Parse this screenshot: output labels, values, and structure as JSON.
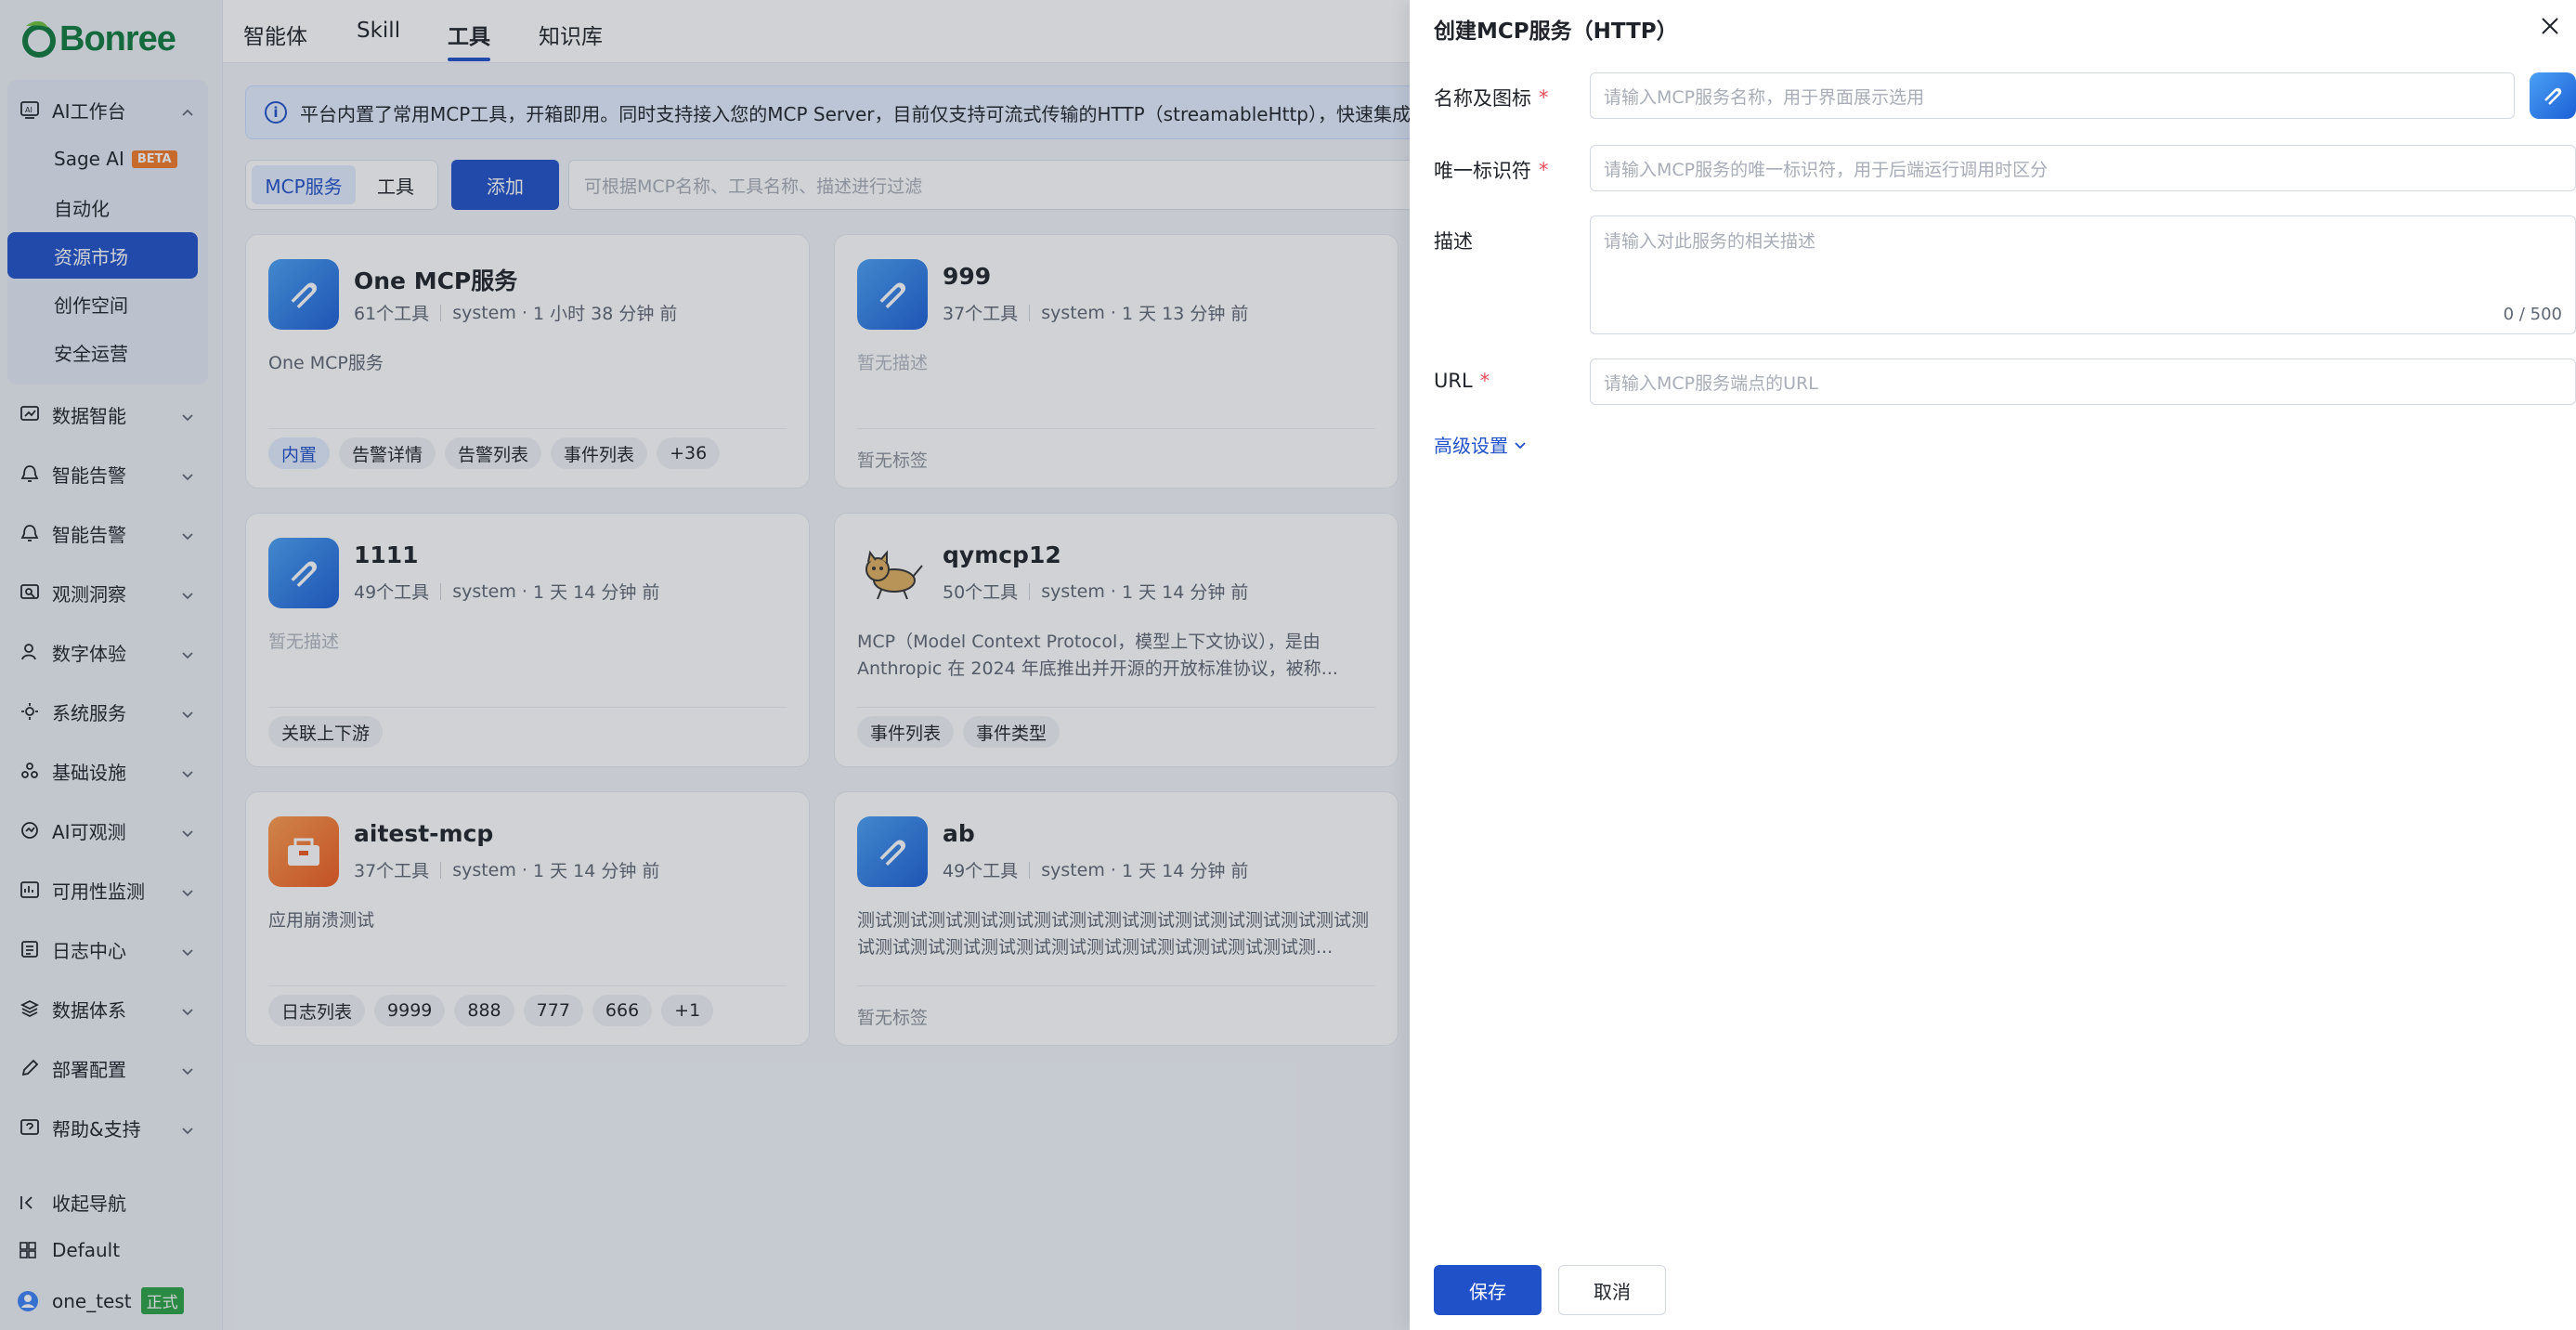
{
  "brand": {
    "name": "Bonree",
    "color": "#0f7a3c"
  },
  "colors": {
    "accent": "#2151c8",
    "beta": "#f47a2a",
    "prod": "#2ba245",
    "required": "#e34d59"
  },
  "sidebar": {
    "group_open": {
      "label": "AI工作台",
      "icon": "ai-workbench-icon",
      "children": [
        {
          "label": "Sage AI",
          "badge": "BETA"
        },
        {
          "label": "自动化"
        },
        {
          "label": "资源市场",
          "active": true
        },
        {
          "label": "创作空间"
        },
        {
          "label": "安全运营"
        }
      ]
    },
    "groups": [
      {
        "label": "数据智能",
        "icon": "data-intelligence-icon"
      },
      {
        "label": "智能告警",
        "icon": "alert-icon"
      },
      {
        "label": "智能告警",
        "icon": "alert-icon"
      },
      {
        "label": "观测洞察",
        "icon": "observe-icon"
      },
      {
        "label": "数字体验",
        "icon": "user-experience-icon"
      },
      {
        "label": "系统服务",
        "icon": "system-service-icon"
      },
      {
        "label": "基础设施",
        "icon": "infrastructure-icon"
      },
      {
        "label": "AI可观测",
        "icon": "ai-observe-icon"
      },
      {
        "label": "可用性监测",
        "icon": "availability-icon"
      },
      {
        "label": "日志中心",
        "icon": "log-icon"
      },
      {
        "label": "数据体系",
        "icon": "data-system-icon"
      },
      {
        "label": "部署配置",
        "icon": "deploy-icon"
      },
      {
        "label": "帮助&支持",
        "icon": "help-icon"
      }
    ],
    "collapse": "收起导航",
    "workspace": "Default",
    "user": {
      "name": "one_test",
      "env": "正式"
    }
  },
  "top_tabs": [
    "智能体",
    "Skill",
    "工具",
    "知识库"
  ],
  "active_tab": "工具",
  "notice": "平台内置了常用MCP工具，开箱即用。同时支持接入您的MCP Server，目前仅支持可流式传输的HTTP（streamableHttp），快速集成",
  "segment": {
    "mcp": "MCP服务",
    "tools": "工具"
  },
  "add_button": "添加",
  "filter_placeholder": "可根据MCP名称、工具名称、描述进行过滤",
  "cards": [
    {
      "title": "One MCP服务",
      "tools": "61个工具",
      "owner": "system",
      "time": "1 小时 38 分钟 前",
      "desc": "One MCP服务",
      "desc_muted": false,
      "tags": [
        "内置",
        "告警详情",
        "告警列表",
        "事件列表",
        "+36"
      ],
      "no_tags": ""
    },
    {
      "title": "999",
      "tools": "37个工具",
      "owner": "system",
      "time": "1 天 13 分钟 前",
      "desc": "暂无描述",
      "desc_muted": true,
      "tags": [],
      "no_tags": "暂无标签"
    },
    {
      "title": "1111",
      "tools": "49个工具",
      "owner": "system",
      "time": "1 天 14 分钟 前",
      "desc": "暂无描述",
      "desc_muted": true,
      "tags": [
        "关联上下游"
      ],
      "no_tags": ""
    },
    {
      "title": "qymcp12",
      "tools": "50个工具",
      "owner": "system",
      "time": "1 天 14 分钟 前",
      "desc": "MCP（Model Context Protocol，模型上下文协议），是由Anthropic 在 2024 年底推出并开源的开放标准协议，被称...",
      "desc_muted": false,
      "tags": [
        "事件列表",
        "事件类型"
      ],
      "no_tags": ""
    },
    {
      "title": "aitest-mcp",
      "tools": "37个工具",
      "owner": "system",
      "time": "1 天 14 分钟 前",
      "desc": "应用崩溃测试",
      "desc_muted": false,
      "tags": [
        "日志列表",
        "9999",
        "888",
        "777",
        "666",
        "+1"
      ],
      "no_tags": ""
    },
    {
      "title": "ab",
      "tools": "49个工具",
      "owner": "system",
      "time": "1 天 14 分钟 前",
      "desc": "测试测试测试测试测试测试测试测试测试测试测试测试测试测试测试测试测试测试测试测试测试测试测试测试测试测试测试测...",
      "desc_muted": false,
      "tags": [],
      "no_tags": "暂无标签"
    }
  ],
  "drawer": {
    "title": "创建MCP服务（HTTP）",
    "name_label": "名称及图标",
    "name_placeholder": "请输入MCP服务名称，用于界面展示选用",
    "id_label": "唯一标识符",
    "id_placeholder": "请输入MCP服务的唯一标识符，用于后端运行调用时区分",
    "desc_label": "描述",
    "desc_placeholder": "请输入对此服务的相关描述",
    "desc_counter": "0 / 500",
    "url_label": "URL",
    "url_placeholder": "请输入MCP服务端点的URL",
    "required_mark": "*",
    "advanced": "高级设置",
    "save": "保存",
    "cancel": "取消"
  }
}
